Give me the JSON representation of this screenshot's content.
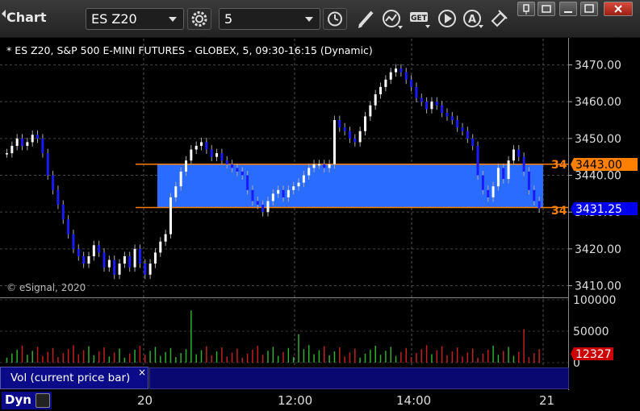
{
  "toolbar": {
    "title": "Chart",
    "symbol_value": "ES Z20",
    "interval_value": "5",
    "icons": [
      "settings-gear-icon",
      "clock-icon",
      "pencil-icon",
      "studies-icon",
      "get-icon",
      "play-icon",
      "alert-icon",
      "link-icon"
    ]
  },
  "chart": {
    "header": "* ES Z20, S&P 500 E-MINI FUTURES - GLOBEX, 5, 09:30-16:15 (Dynamic)",
    "copyright": "© eSignal, 2020",
    "price_axis_ticks": [
      "3470.00",
      "3460.00",
      "3450.00",
      "3440.00",
      "3430.00",
      "3420.00",
      "3410.00"
    ],
    "price_axis_range": [
      3406.5,
      3473.5
    ],
    "range_box": {
      "high": 3443.0,
      "low": 3431.25
    },
    "high_marker": {
      "value": "3443.00",
      "short_label": "34",
      "color": "#ff8000"
    },
    "low_marker": {
      "value": "3431.25",
      "short_label": "34",
      "color": "#0000ee"
    },
    "colors": {
      "up": "#ffffff",
      "down": "#1a1aff",
      "box_fill": "#2a6cff",
      "box_edge": "#ff8000"
    }
  },
  "volume": {
    "label": "Vol (current price bar)",
    "close_symbol": "×",
    "axis_ticks": [
      "100000",
      "50000",
      "0"
    ],
    "last_value": "12327",
    "last_color": "#cc0000"
  },
  "time_axis": {
    "labels": [
      "20",
      "12:00",
      "14:00",
      "21"
    ]
  },
  "footer": {
    "mode": "Dyn"
  }
}
